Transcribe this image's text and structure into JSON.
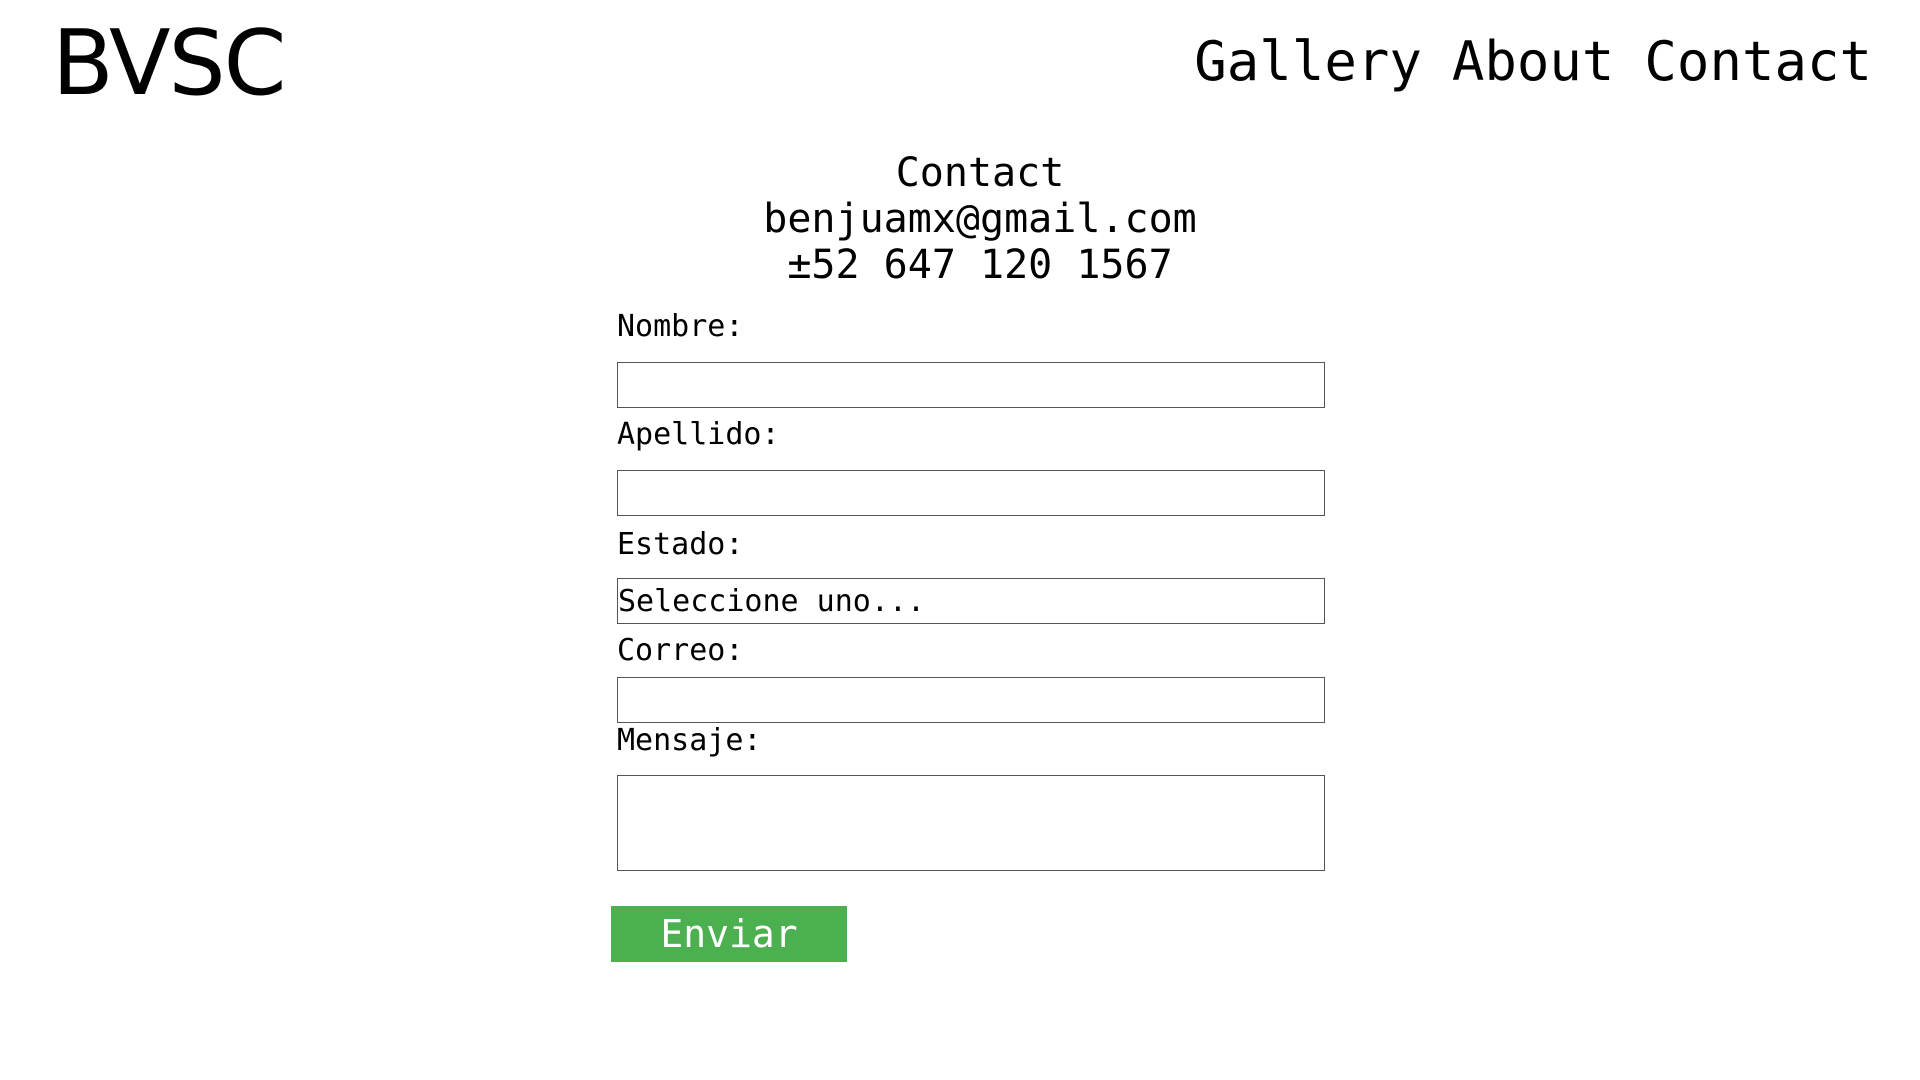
{
  "header": {
    "logo": "BVSC",
    "nav": [
      {
        "label": "Gallery"
      },
      {
        "label": "About"
      },
      {
        "label": "Contact"
      }
    ]
  },
  "contact": {
    "title": "Contact",
    "email": "benjuamx@gmail.com",
    "phone": "±52 647 120 1567"
  },
  "form": {
    "nombre_label": "Nombre:",
    "nombre_value": "",
    "apellido_label": "Apellido:",
    "apellido_value": "",
    "estado_label": "Estado:",
    "estado_selected": "Seleccione uno...",
    "correo_label": "Correo:",
    "correo_value": "",
    "mensaje_label": "Mensaje:",
    "mensaje_value": "",
    "submit_label": "Enviar"
  },
  "colors": {
    "submit_background": "#4caf50",
    "submit_text": "#ffffff",
    "text": "#000000",
    "field_border": "#555555"
  }
}
